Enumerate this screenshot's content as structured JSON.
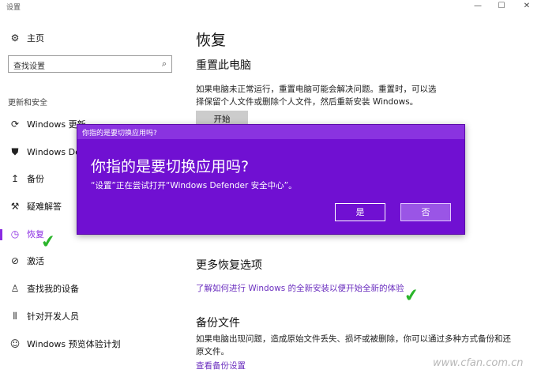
{
  "window": {
    "title": "设置",
    "controls": {
      "minimize": "—",
      "maximize": "☐",
      "close": "✕"
    }
  },
  "sidebar": {
    "home": "主页",
    "search_placeholder": "查找设置",
    "section": "更新和安全",
    "items": [
      {
        "label": "Windows 更新",
        "icon": "refresh-icon",
        "glyph": "⟳"
      },
      {
        "label": "Windows Def",
        "icon": "shield-icon",
        "glyph": "⛊"
      },
      {
        "label": "备份",
        "icon": "backup-icon",
        "glyph": "↥"
      },
      {
        "label": "疑难解答",
        "icon": "wrench-icon",
        "glyph": "⚒"
      },
      {
        "label": "恢复",
        "icon": "history-icon",
        "glyph": "◷",
        "active": true
      },
      {
        "label": "激活",
        "icon": "check-circle-icon",
        "glyph": "⊘"
      },
      {
        "label": "查找我的设备",
        "icon": "person-location-icon",
        "glyph": "♙"
      },
      {
        "label": "针对开发人员",
        "icon": "developer-icon",
        "glyph": "⫴"
      },
      {
        "label": "Windows 预览体验计划",
        "icon": "insider-icon",
        "glyph": "☺"
      }
    ]
  },
  "main": {
    "title": "恢复",
    "reset": {
      "heading": "重置此电脑",
      "line1": "如果电脑未正常运行，重置电脑可能会解决问题。重置时，可以选",
      "line2": "择保留个人文件或删除个人文件，然后重新安装 Windows。",
      "button": "开始"
    },
    "more": {
      "heading": "更多恢复选项",
      "link": "了解如何进行 Windows 的全新安装以便开始全新的体验"
    },
    "backup": {
      "heading": "备份文件",
      "line1": "如果电脑出现问题，造成原始文件丢失、损坏或被删除，你可以通过多种方式备份和还",
      "line2": "原文件。",
      "link": "查看备份设置"
    }
  },
  "dialog": {
    "titlebar": "你指的是要切换应用吗?",
    "heading": "你指的是要切换应用吗?",
    "message": "“设置”正在尝试打开“Windows Defender 安全中心”。",
    "yes": "是",
    "no": "否"
  },
  "watermark": "www.cfan.com.cn",
  "colors": {
    "accent": "#8a2be2",
    "dialog_bg": "#7010d2",
    "check": "#2bb52b"
  }
}
